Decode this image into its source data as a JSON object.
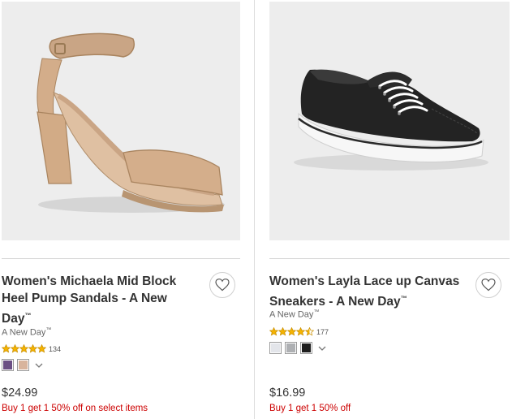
{
  "products": [
    {
      "title": "Women's Michaela Mid Block Heel Pump Sandals - A New Day",
      "title_tm": "™",
      "brand": "A New Day",
      "brand_tm": "™",
      "rating": 5,
      "review_count": "134",
      "swatch_colors": [
        "#6b4f84",
        "#d8b49c"
      ],
      "price": "$24.99",
      "promo": "Buy 1 get 1 50% off on select items",
      "icon_favorite": "heart-outline-icon",
      "icon_more_colors": "chevron-down-icon"
    },
    {
      "title": "Women's Layla Lace up Canvas Sneakers - A New Day",
      "title_tm": "™",
      "brand": "A New Day",
      "brand_tm": "™",
      "rating": 4.5,
      "review_count": "177",
      "swatch_colors": [
        "#e3e5ea",
        "#aeb0b3",
        "#1e1e1e"
      ],
      "price": "$16.99",
      "promo": "Buy 1 get 1 50% off",
      "icon_favorite": "heart-outline-icon",
      "icon_more_colors": "chevron-down-icon"
    }
  ],
  "colors": {
    "promo": "#cc0000",
    "star": "#f5b301",
    "image_bg": "#ededed"
  }
}
